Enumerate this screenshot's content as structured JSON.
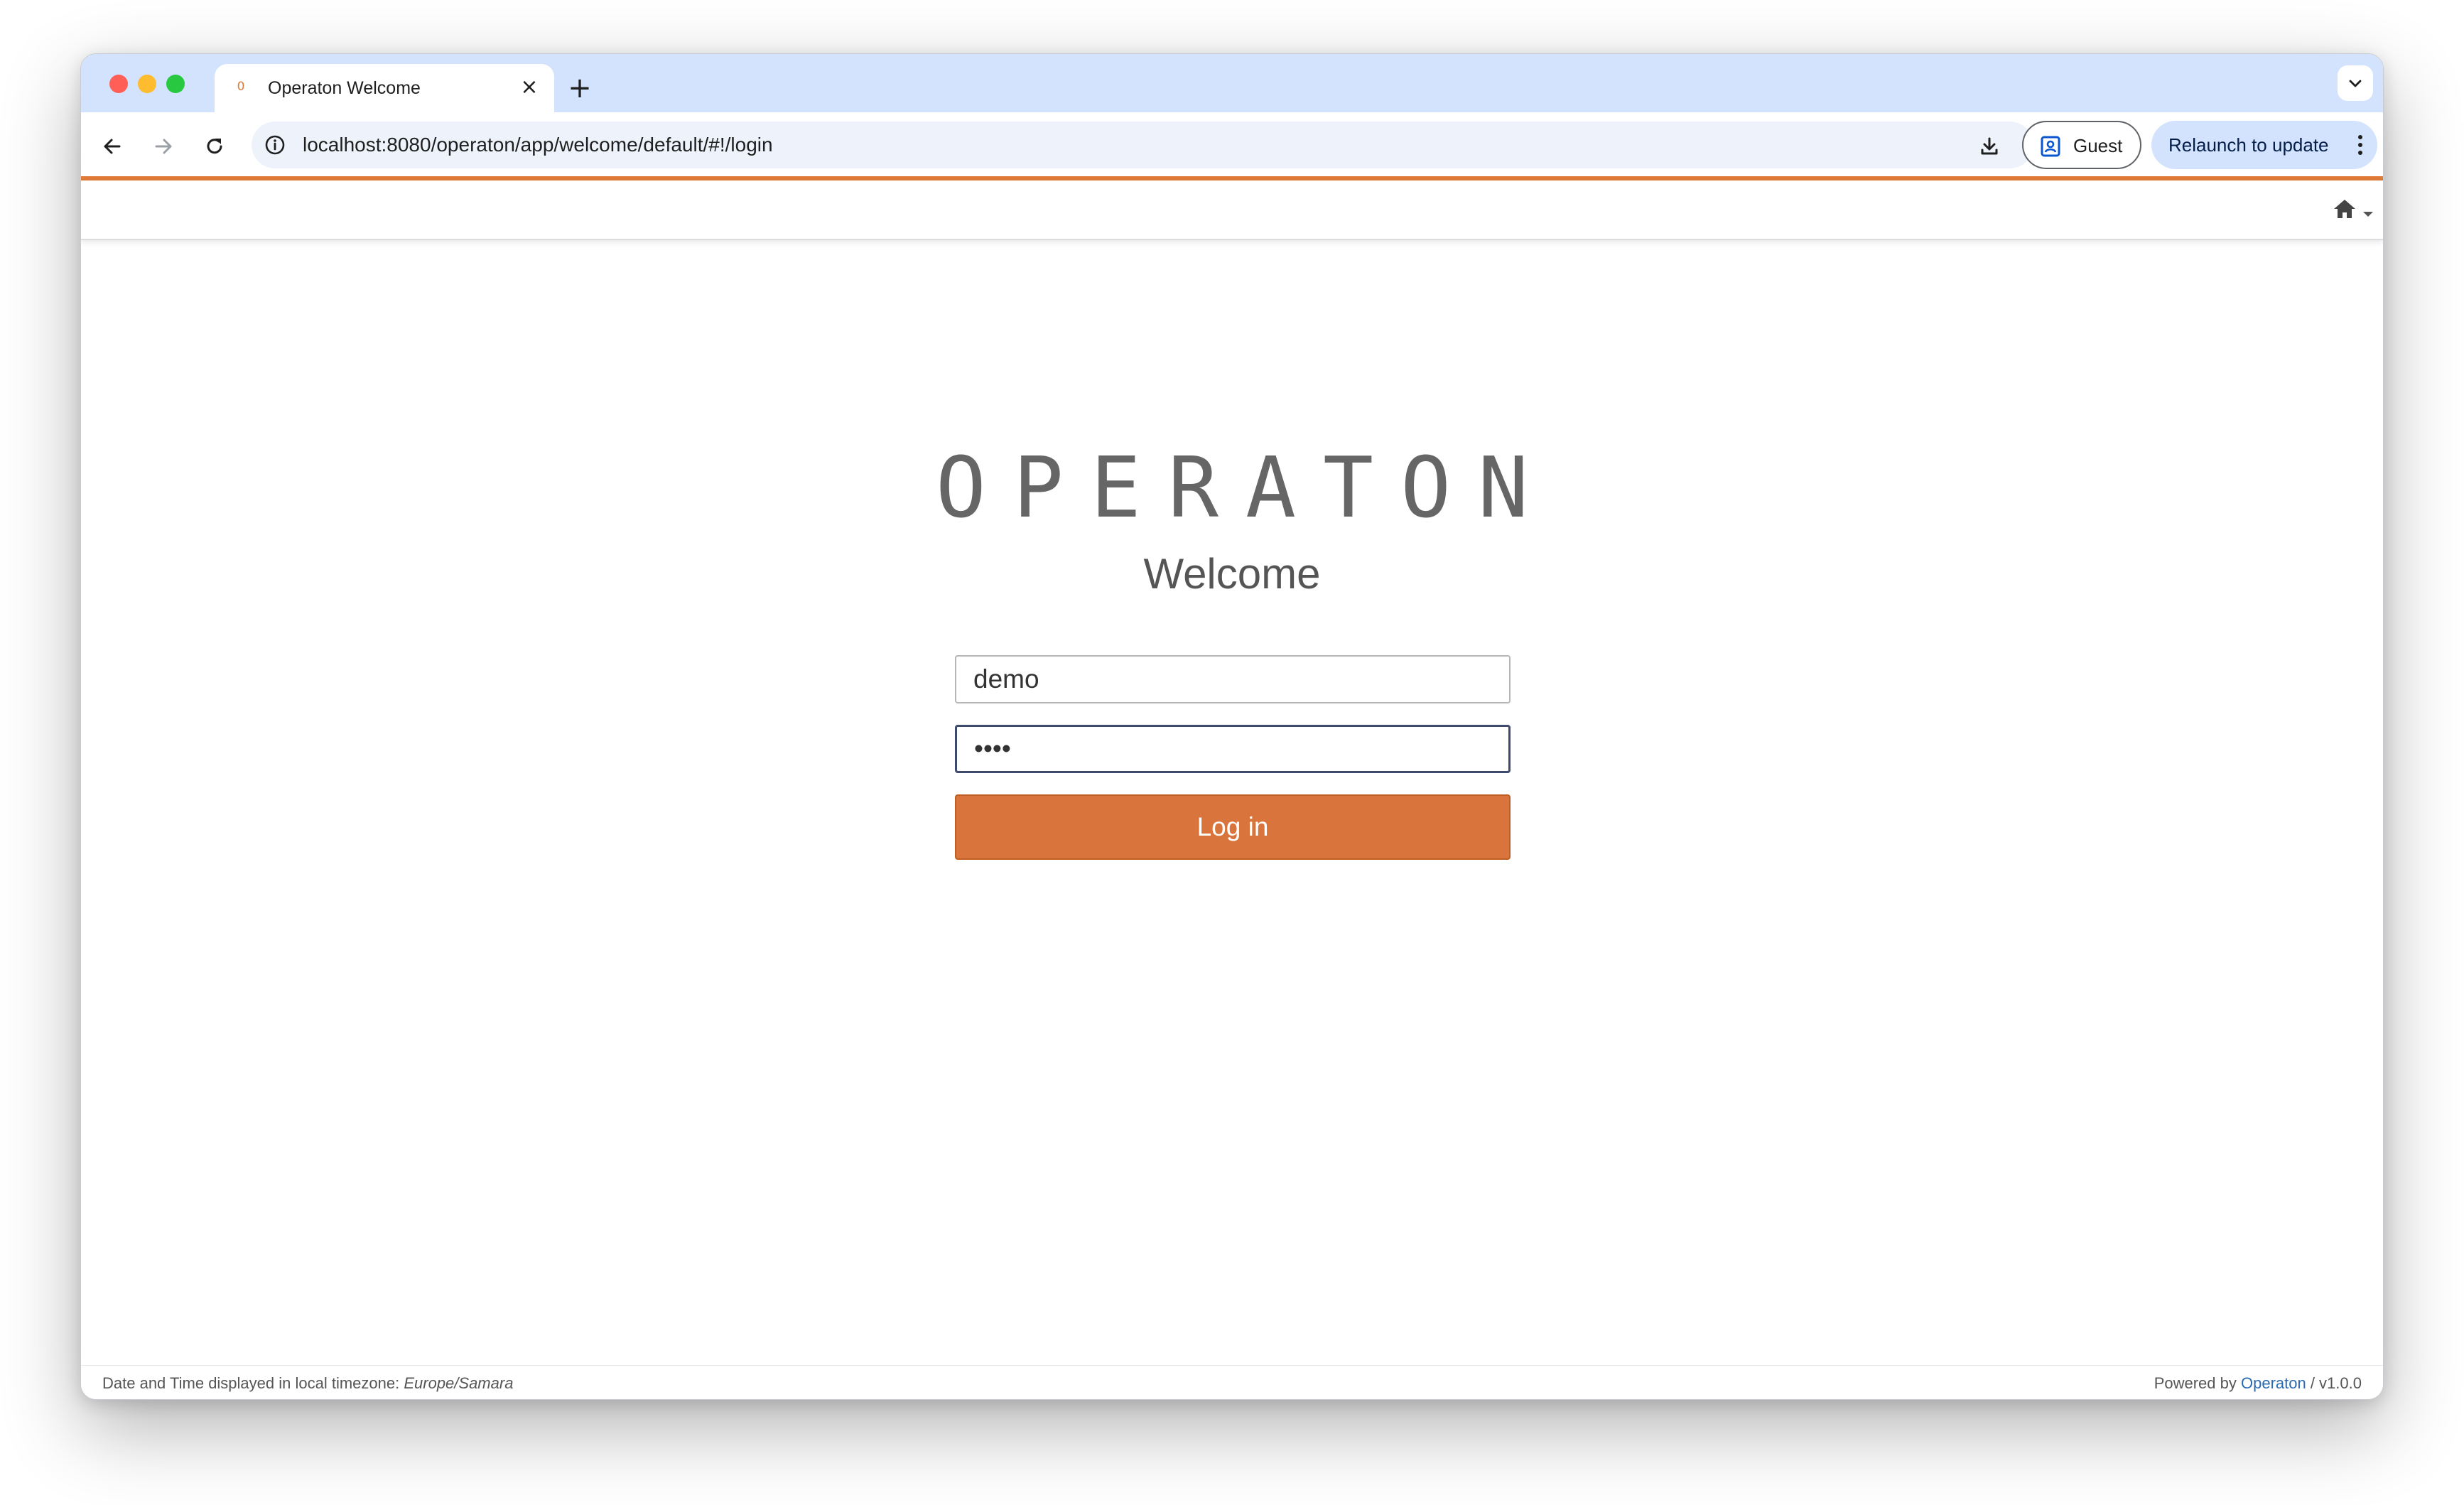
{
  "browser": {
    "tab_title": "Operaton Welcome",
    "tab_favicon": "operaton-favicon",
    "tab_close": "×",
    "new_tab": "+",
    "url": "localhost:8080/operaton/app/welcome/default/#!/login",
    "profile_label": "Guest",
    "relaunch_label": "Relaunch to update",
    "icons": {
      "back": "arrow-left-icon",
      "forward": "arrow-right-icon",
      "reload": "reload-icon",
      "site_info": "info-icon",
      "download": "download-icon",
      "profile": "profile-icon",
      "menu": "kebab-menu-icon",
      "tab_search": "chevron-down-icon"
    }
  },
  "app": {
    "brand": "OPERATON",
    "subtitle": "Welcome",
    "username_value": "demo",
    "password_value": "demo",
    "login_label": "Log in",
    "header_icon": "home-icon",
    "accent_color": "#e07b39",
    "button_color": "#d9743c"
  },
  "footer": {
    "timezone_prefix": "Date and Time displayed in local timezone: ",
    "timezone": "Europe/Samara",
    "powered_prefix": "Powered by ",
    "powered_link": "Operaton",
    "version": " / v1.0.0"
  }
}
